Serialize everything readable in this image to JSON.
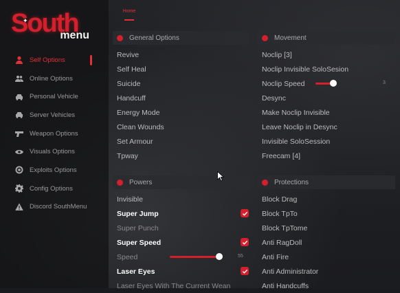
{
  "logo": {
    "brand": "South",
    "sub": "menu"
  },
  "top_tab": {
    "label": "Home"
  },
  "sidebar": {
    "items": [
      {
        "label": "Self Options",
        "icon": "user-icon"
      },
      {
        "label": "Online Options",
        "icon": "users-icon"
      },
      {
        "label": "Personal Vehicle",
        "icon": "car-icon"
      },
      {
        "label": "Server Vehicles",
        "icon": "car-icon"
      },
      {
        "label": "Weapon Options",
        "icon": "gun-icon"
      },
      {
        "label": "Visuals Options",
        "icon": "eye-icon"
      },
      {
        "label": "Exploits Options",
        "icon": "target-icon"
      },
      {
        "label": "Config Options",
        "icon": "gear-icon"
      },
      {
        "label": "Discord SouthMenu",
        "icon": "warning-icon"
      }
    ]
  },
  "general": {
    "title": "General Options",
    "items": [
      "Revive",
      "Self Heal",
      "Suicide",
      "Handcuff",
      "Energy Mode",
      "Clean Wounds",
      "Set Armour",
      "Tpway"
    ]
  },
  "movement": {
    "title": "Movement",
    "items": [
      "Noclip [3]",
      "Noclip Invisible SoloSesion",
      "Noclip Speed",
      "Desync",
      "Make Noclip Invisible",
      "Leave Noclip in Desync",
      "Invisible SoloSession",
      "Freecam [4]"
    ],
    "noclip_speed_value": "3",
    "noclip_speed_level": 0.3
  },
  "powers": {
    "title": "Powers",
    "items": [
      {
        "label": "Invisible",
        "checked": false
      },
      {
        "label": "Super Jump",
        "checked": true
      },
      {
        "label": "Super Punch",
        "checked": false
      },
      {
        "label": "Super Speed",
        "checked": true
      },
      {
        "label": "Speed",
        "slider": true
      },
      {
        "label": "Laser Eyes",
        "checked": true
      },
      {
        "label": "Laser Eyes With The Current Wean",
        "checked": false
      }
    ],
    "speed_value": "55",
    "speed_level": 0.8
  },
  "protections": {
    "title": "Protections",
    "items": [
      "Block Drag",
      "Block TpTo",
      "Block TpTome",
      "Anti RagDoll",
      "Anti Fire",
      "Anti Administrator",
      "Anti Handcuffs"
    ]
  },
  "colors": {
    "accent": "#d41f2c",
    "bg": "#1a1b1e"
  }
}
